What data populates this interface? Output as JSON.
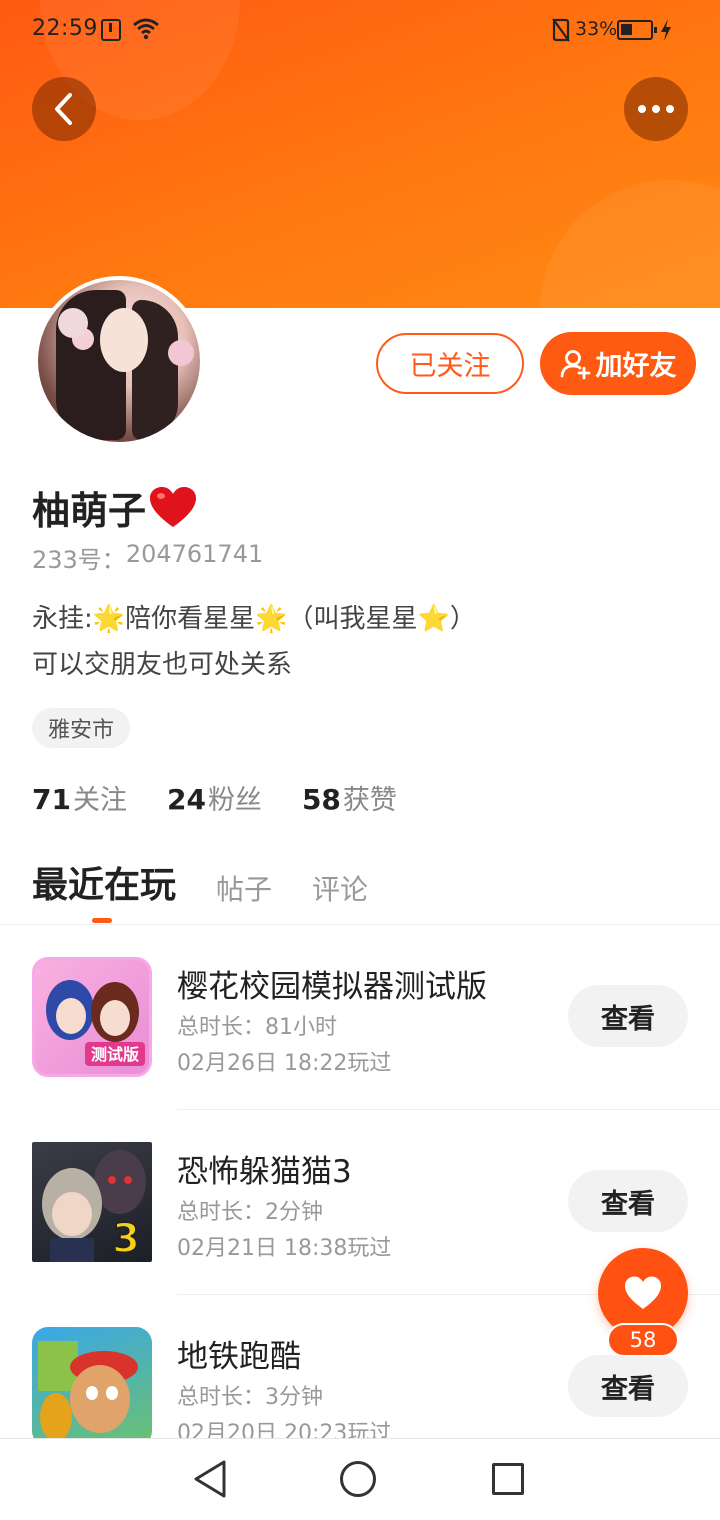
{
  "status_bar": {
    "time": "22:59",
    "battery_pct": "33%"
  },
  "profile": {
    "name": "柚萌子",
    "name_emoji": "❤️",
    "uid_label": "233号：",
    "uid": "204761741",
    "bio_prefix": "永挂:",
    "bio_part1": "陪你看星星",
    "bio_part2": "（叫我星星",
    "bio_part3": "）",
    "bio_line2": "可以交朋友也可处关系",
    "location": "雅安市"
  },
  "actions": {
    "followed": "已关注",
    "add_friend": "加好友"
  },
  "stats": {
    "following_count": "71",
    "following_label": "关注",
    "fans_count": "24",
    "fans_label": "粉丝",
    "likes_count": "58",
    "likes_label": "获赞"
  },
  "tabs": [
    "最近在玩",
    "帖子",
    "评论"
  ],
  "games": [
    {
      "title": "樱花校园模拟器测试版",
      "duration_label": "总时长：",
      "duration": "81小时",
      "last_played": "02月26日 18:22玩过",
      "button": "查看"
    },
    {
      "title": "恐怖躲猫猫3",
      "duration_label": "总时长：",
      "duration": "2分钟",
      "last_played": "02月21日 18:38玩过",
      "button": "查看"
    },
    {
      "title": "地铁跑酷",
      "duration_label": "总时长：",
      "duration": "3分钟",
      "last_played": "02月20日 20:23玩过",
      "button": "查看"
    }
  ],
  "fab": {
    "like_count": "58"
  },
  "colors": {
    "accent": "#ff5a12",
    "header": "#ff7810"
  }
}
